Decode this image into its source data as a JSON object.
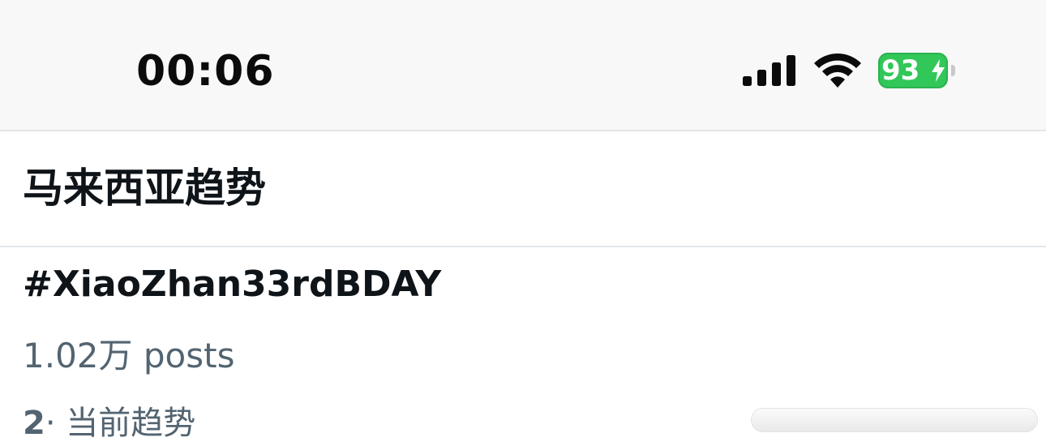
{
  "status_bar": {
    "time": "00:06",
    "battery_level": "93",
    "signal_bars": 4,
    "icons": [
      "cellular-signal-icon",
      "wifi-icon",
      "battery-charging-icon"
    ],
    "colors": {
      "battery": "#32c759",
      "background": "#f8f8f8"
    }
  },
  "header": {
    "title": "马来西亚趋势"
  },
  "trends": [
    {
      "name": "#XiaoZhan33rdBDAY",
      "posts": "1.02万 posts"
    }
  ],
  "next_trend": {
    "rank": "2",
    "separator": "·",
    "context": "当前趋势"
  },
  "colors": {
    "primary_text": "#0f1419",
    "secondary_text": "#536471",
    "divider": "#e3e6e8"
  }
}
